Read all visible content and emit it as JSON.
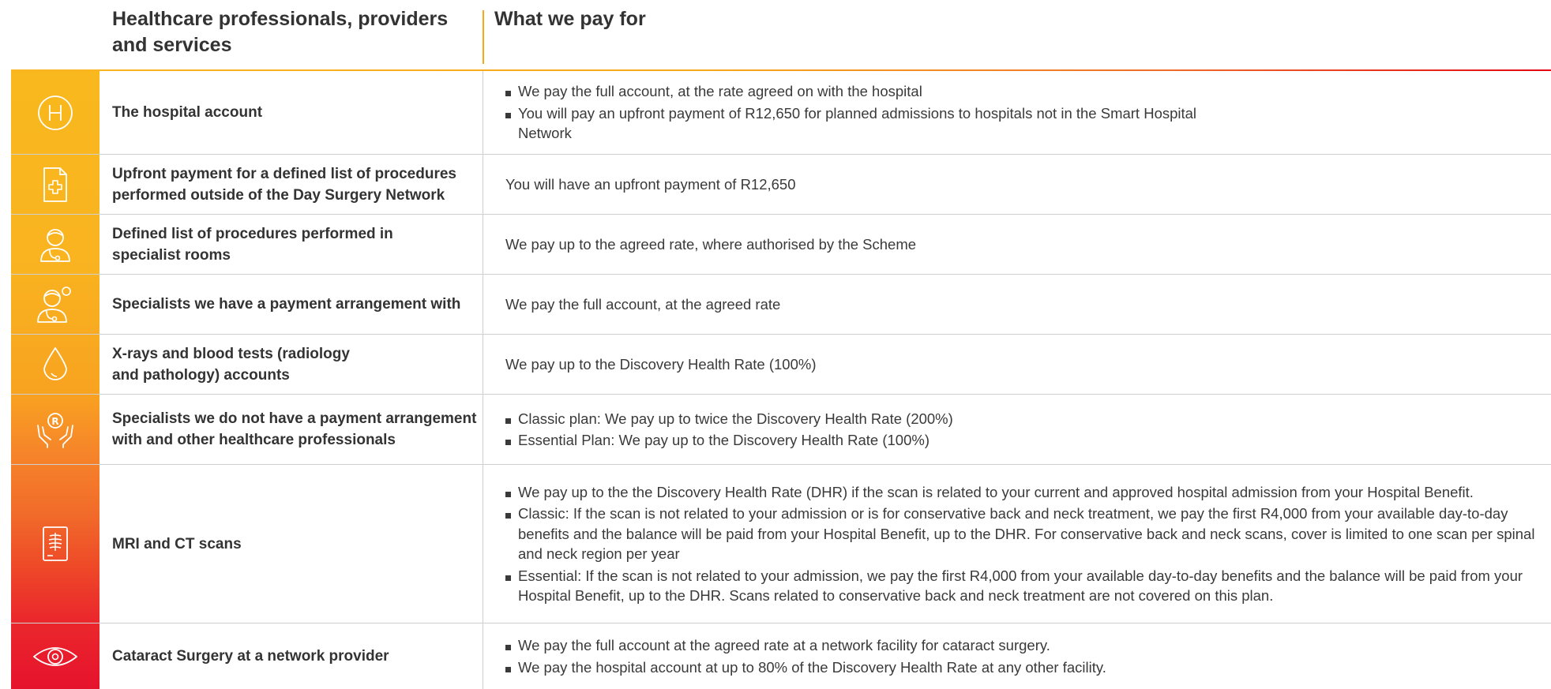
{
  "header": {
    "col1": "Healthcare professionals, providers and services",
    "col2": "What we pay for"
  },
  "rows": [
    {
      "icon": "hospital-h-icon",
      "label": "The hospital account",
      "bullets": [
        "We pay the full account, at the rate agreed on with the hospital",
        "You will pay an upfront payment of R12,650 for planned admissions to hospitals not in the Smart Hospital Network"
      ]
    },
    {
      "icon": "medical-document-icon",
      "label": "Upfront payment for a defined list of procedures performed outside of the Day Surgery Network",
      "text": "You will have an upfront payment of R12,650"
    },
    {
      "icon": "doctor-icon",
      "label": "Defined list of procedures performed in specialist rooms",
      "text": "We pay up to the agreed rate, where authorised by the Scheme"
    },
    {
      "icon": "specialist-doctor-icon",
      "label": "Specialists we have a payment arrangement with",
      "text": "We pay the full account, at the agreed rate"
    },
    {
      "icon": "blood-drop-icon",
      "label": "X-rays and blood tests (radiology and pathology) accounts",
      "text": "We pay up to the Discovery Health Rate (100%)"
    },
    {
      "icon": "hands-registered-icon",
      "label": "Specialists we do not have a payment arrangement with and other healthcare professionals",
      "bullets": [
        "Classic plan: We pay up to twice the Discovery Health Rate (200%)",
        "Essential Plan: We pay up to the Discovery Health Rate (100%)"
      ]
    },
    {
      "icon": "xray-scan-icon",
      "label": "MRI and CT scans",
      "bullets": [
        "We pay up to the the Discovery Health Rate (DHR) if the scan is related to your current and approved hospital admission from your Hospital Benefit.",
        "Classic: If the scan is not related to your admission or is for conservative back and neck treatment, we pay the first R4,000 from your available day-to-day benefits and the balance will be paid from your Hospital Benefit, up to the DHR. For conservative back and neck scans, cover is limited to one scan per spinal and neck region per year",
        "Essential: If the scan is not related to your admission, we pay the first R4,000 from your available day-to-day benefits and the balance will be paid from your Hospital Benefit, up to the DHR. Scans related to conservative back and neck treatment are not covered on this plan."
      ]
    },
    {
      "icon": "eye-icon",
      "label": "Cataract Surgery at a network provider",
      "bullets": [
        "We pay the full account at the agreed rate at a network facility for cataract surgery.",
        "We pay the hospital account at up to 80% of the Discovery Health Rate at any other facility."
      ]
    }
  ]
}
